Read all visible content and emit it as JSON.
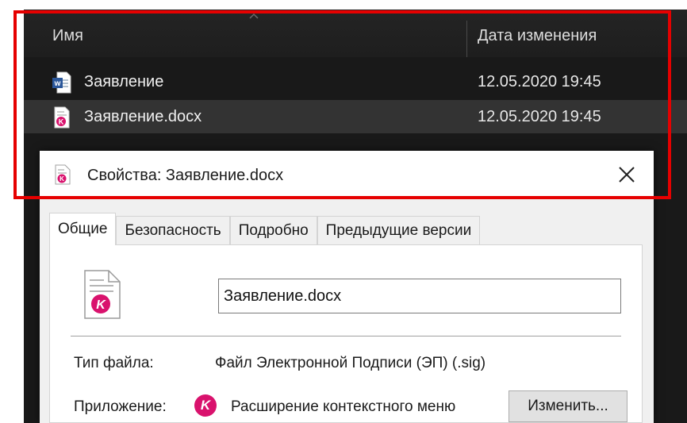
{
  "explorer": {
    "columns": {
      "name": "Имя",
      "date_modified": "Дата изменения"
    },
    "files": [
      {
        "name": "Заявление",
        "date": "12.05.2020 19:45",
        "icon": "word-document-icon",
        "selected": false
      },
      {
        "name": "Заявление.docx",
        "date": "12.05.2020 19:45",
        "icon": "signed-document-icon",
        "selected": true
      }
    ]
  },
  "dialog": {
    "title": "Свойства: Заявление.docx",
    "tabs": [
      "Общие",
      "Безопасность",
      "Подробно",
      "Предыдущие версии"
    ],
    "active_tab": "Общие",
    "filename_value": "Заявление.docx",
    "file_type_label": "Тип файла:",
    "file_type_value": "Файл Электронной Подписи (ЭП) (.sig)",
    "app_label": "Приложение:",
    "app_icon_letter": "K",
    "app_name": "Расширение контекстного меню",
    "change_button": "Изменить..."
  },
  "colors": {
    "highlight": "#e60000",
    "app_accent": "#d9126d",
    "word_blue": "#2b579a",
    "explorer_bg": "#191919"
  }
}
